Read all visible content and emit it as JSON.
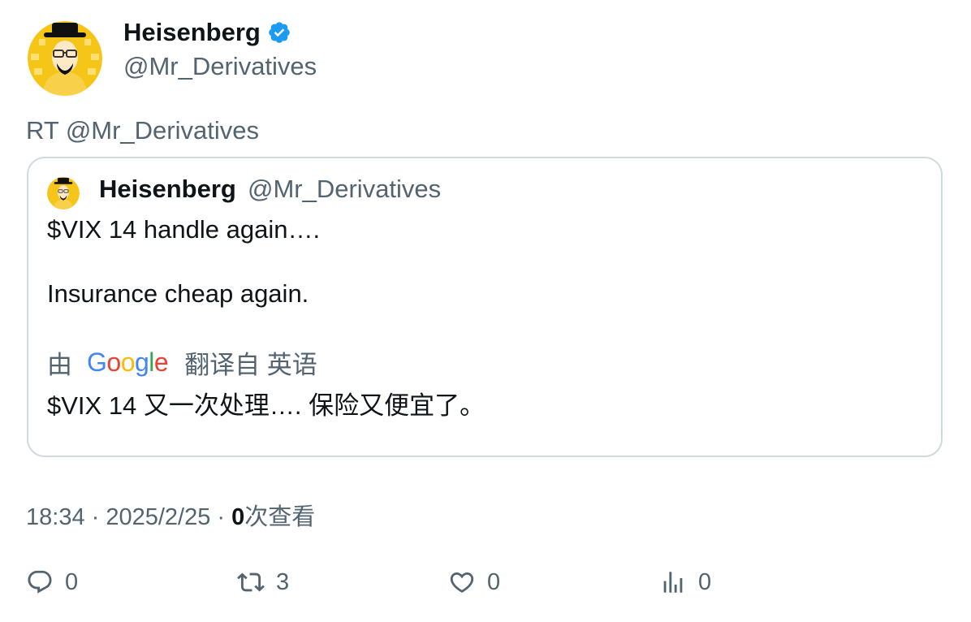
{
  "author": {
    "name": "Heisenberg",
    "handle": "@Mr_Derivatives"
  },
  "retweet_line": "RT @Mr_Derivatives",
  "quote": {
    "name": "Heisenberg",
    "handle": "@Mr_Derivatives",
    "line1": "$VIX 14 handle again….",
    "line2": "Insurance cheap again.",
    "translation": {
      "by": "由",
      "google": [
        "G",
        "o",
        "o",
        "g",
        "l",
        "e"
      ],
      "from": "翻译自 英语",
      "text": "$VIX 14 又一次处理…. 保险又便宜了。"
    }
  },
  "meta": {
    "time": "18:34",
    "sep1": " · ",
    "date": "2025/2/25",
    "sep2": " · ",
    "views_count": "0",
    "views_label": "次查看"
  },
  "actions": {
    "reply": "0",
    "retweet": "3",
    "like": "0",
    "views": "0"
  },
  "colors": {
    "verified": "#1d9bf0",
    "avatar_bg": "#f5c518",
    "muted": "#536471",
    "google": [
      "#4285F4",
      "#EA4335",
      "#FBBC05",
      "#4285F4",
      "#34A853",
      "#EA4335"
    ]
  }
}
